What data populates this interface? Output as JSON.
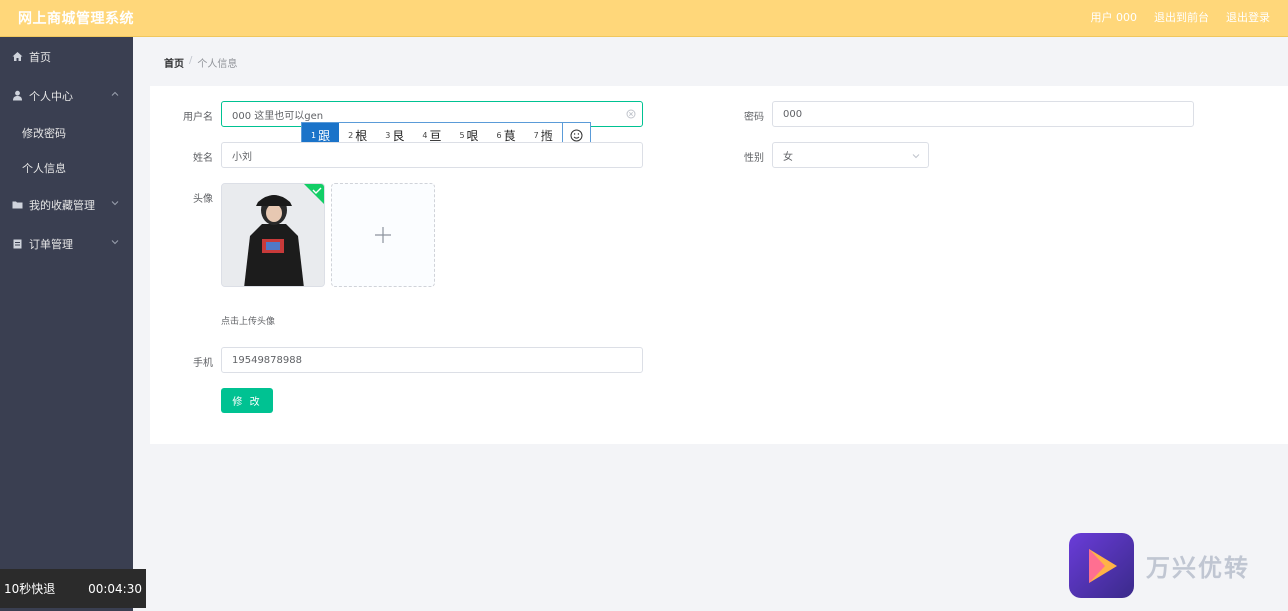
{
  "header": {
    "title": "网上商城管理系统",
    "user_label": "用户 000",
    "back_frontend": "退出到前台",
    "logout": "退出登录"
  },
  "sidebar": {
    "items": [
      {
        "label": "首页",
        "icon": "home-icon"
      },
      {
        "label": "个人中心",
        "icon": "user-icon",
        "expanded": true,
        "children": [
          {
            "label": "修改密码"
          },
          {
            "label": "个人信息"
          }
        ]
      },
      {
        "label": "我的收藏管理",
        "icon": "folder-icon"
      },
      {
        "label": "订单管理",
        "icon": "clipboard-icon"
      }
    ]
  },
  "breadcrumb": {
    "home": "首页",
    "separator": "/",
    "current": "个人信息"
  },
  "form": {
    "username_label": "用户名",
    "username_value": "000  这里也可以gen",
    "password_label": "密码",
    "password_value": "000",
    "name_label": "姓名",
    "name_value": "小刘",
    "gender_label": "性别",
    "gender_value": "女",
    "avatar_label": "头像",
    "upload_hint": "点击上传头像",
    "phone_label": "手机",
    "phone_value": "19549878988",
    "submit_label": "修 改"
  },
  "ime": {
    "candidates": [
      {
        "num": "1",
        "char": "跟"
      },
      {
        "num": "2",
        "char": "根"
      },
      {
        "num": "3",
        "char": "艮"
      },
      {
        "num": "4",
        "char": "亘"
      },
      {
        "num": "5",
        "char": "哏"
      },
      {
        "num": "6",
        "char": "茛"
      },
      {
        "num": "7",
        "char": "揯"
      }
    ]
  },
  "player": {
    "rewind_label": "10秒快退",
    "time": "00:04:30"
  },
  "watermark": {
    "text": "万兴优转"
  },
  "colors": {
    "header_bg": "#ffd77a",
    "sidebar_bg": "#3a3f51",
    "accent": "#00c292",
    "ime_selected": "#1a73c9"
  }
}
